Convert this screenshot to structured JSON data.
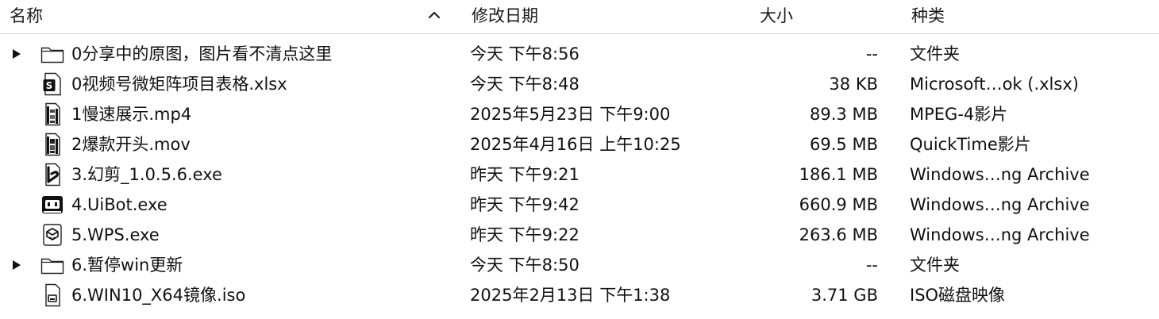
{
  "columns": {
    "name": "名称",
    "date": "修改日期",
    "size": "大小",
    "kind": "种类"
  },
  "files": [
    {
      "name": "0分享中的原图，图片看不清点这里",
      "date": "今天 下午8:56",
      "size": "--",
      "kind": "文件夹",
      "icon": "folder-icon",
      "expandable": true
    },
    {
      "name": "0视频号微矩阵项目表格.xlsx",
      "date": "今天 下午8:48",
      "size": "38 KB",
      "kind": "Microsoft…ok (.xlsx)",
      "icon": "spreadsheet-icon",
      "expandable": false
    },
    {
      "name": "1慢速展示.mp4",
      "date": "2025年5月23日 下午9:00",
      "size": "89.3 MB",
      "kind": "MPEG-4影片",
      "icon": "video-file-icon",
      "expandable": false
    },
    {
      "name": "2爆款开头.mov",
      "date": "2025年4月16日 上午10:25",
      "size": "69.5 MB",
      "kind": "QuickTime影片",
      "icon": "video-file-icon",
      "expandable": false
    },
    {
      "name": "3.幻剪_1.0.5.6.exe",
      "date": "昨天 下午9:21",
      "size": "186.1 MB",
      "kind": "Windows…ng Archive",
      "icon": "app-exe-icon",
      "expandable": false
    },
    {
      "name": "4.UiBot.exe",
      "date": "昨天 下午9:42",
      "size": "660.9 MB",
      "kind": "Windows…ng Archive",
      "icon": "robot-exe-icon",
      "expandable": false
    },
    {
      "name": "5.WPS.exe",
      "date": "昨天 下午9:22",
      "size": "263.6 MB",
      "kind": "Windows…ng Archive",
      "icon": "installer-exe-icon",
      "expandable": false
    },
    {
      "name": "6.暂停win更新",
      "date": "今天 下午8:50",
      "size": "--",
      "kind": "文件夹",
      "icon": "folder-icon",
      "expandable": true
    },
    {
      "name": "6.WIN10_X64镜像.iso",
      "date": "2025年2月13日 下午1:38",
      "size": "3.71 GB",
      "kind": "ISO磁盘映像",
      "icon": "disk-image-icon",
      "expandable": false
    }
  ]
}
